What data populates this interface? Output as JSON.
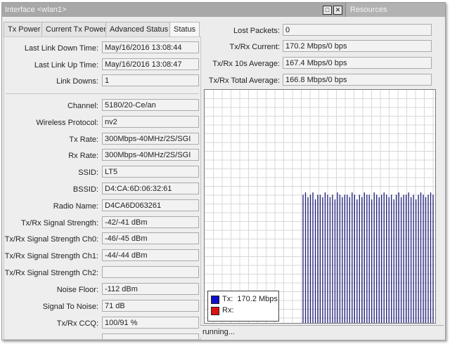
{
  "window": {
    "title": "Interface <wlan1>",
    "restore_glyph": "□",
    "close_glyph": "✕",
    "resources_label": "Resources"
  },
  "tabs": [
    "Tx Power",
    "Current Tx Power",
    "Advanced Status",
    "Status"
  ],
  "active_tab": "Status",
  "left_fields": [
    {
      "label": "Last Link Down Time:",
      "value": "May/16/2016 13:08:44"
    },
    {
      "label": "Last Link Up Time:",
      "value": "May/16/2016 13:08:47"
    },
    {
      "label": "Link Downs:",
      "value": "1"
    },
    {
      "label": "Channel:",
      "value": "5180/20-Ce/an"
    },
    {
      "label": "Wireless Protocol:",
      "value": "nv2"
    },
    {
      "label": "Tx Rate:",
      "value": "300Mbps-40MHz/2S/SGI"
    },
    {
      "label": "Rx Rate:",
      "value": "300Mbps-40MHz/2S/SGI"
    },
    {
      "label": "SSID:",
      "value": "LT5"
    },
    {
      "label": "BSSID:",
      "value": "D4:CA:6D:06:32:61"
    },
    {
      "label": "Radio Name:",
      "value": "D4CA6D063261"
    },
    {
      "label": "Tx/Rx Signal Strength:",
      "value": "-42/-41 dBm"
    },
    {
      "label": "Tx/Rx Signal Strength Ch0:",
      "value": "-46/-45 dBm"
    },
    {
      "label": "Tx/Rx Signal Strength Ch1:",
      "value": "-44/-44 dBm"
    },
    {
      "label": "Tx/Rx Signal Strength Ch2:",
      "value": ""
    },
    {
      "label": "Noise Floor:",
      "value": "-112 dBm"
    },
    {
      "label": "Signal To Noise:",
      "value": "71 dB"
    },
    {
      "label": "Tx/Rx CCQ:",
      "value": "100/91 %"
    }
  ],
  "right_fields": [
    {
      "label": "Lost Packets:",
      "value": "0"
    },
    {
      "label": "Tx/Rx Current:",
      "value": "170.2 Mbps/0 bps"
    },
    {
      "label": "Tx/Rx 10s Average:",
      "value": "167.4 Mbps/0 bps"
    },
    {
      "label": "Tx/Rx Total Average:",
      "value": "166.8 Mbps/0 bps"
    }
  ],
  "legend": {
    "tx_label": "Tx:",
    "tx_value": "170.2 Mbps",
    "rx_label": "Rx:",
    "tx_color": "#1010cc",
    "rx_color": "#dd1111"
  },
  "graph": {
    "bar_color": "#1a1a7a",
    "grid_color": "#d8d8d8"
  },
  "chart_data": {
    "type": "bar",
    "series": [
      {
        "name": "Tx",
        "values": [
          0.55,
          0.56,
          0.54,
          0.55,
          0.56,
          0.53,
          0.55,
          0.55,
          0.54,
          0.56,
          0.55,
          0.54,
          0.55,
          0.53,
          0.56,
          0.55,
          0.54,
          0.55,
          0.55,
          0.54,
          0.56,
          0.55,
          0.53,
          0.55,
          0.54,
          0.56,
          0.55,
          0.55,
          0.53,
          0.56,
          0.55,
          0.54,
          0.55,
          0.56,
          0.55,
          0.54,
          0.55,
          0.53,
          0.55,
          0.56,
          0.54,
          0.55,
          0.55,
          0.56,
          0.54,
          0.55,
          0.53,
          0.55,
          0.56,
          0.55,
          0.54,
          0.55,
          0.56,
          0.55
        ]
      }
    ],
    "ylim": [
      0,
      1
    ]
  },
  "status_text": "running..."
}
